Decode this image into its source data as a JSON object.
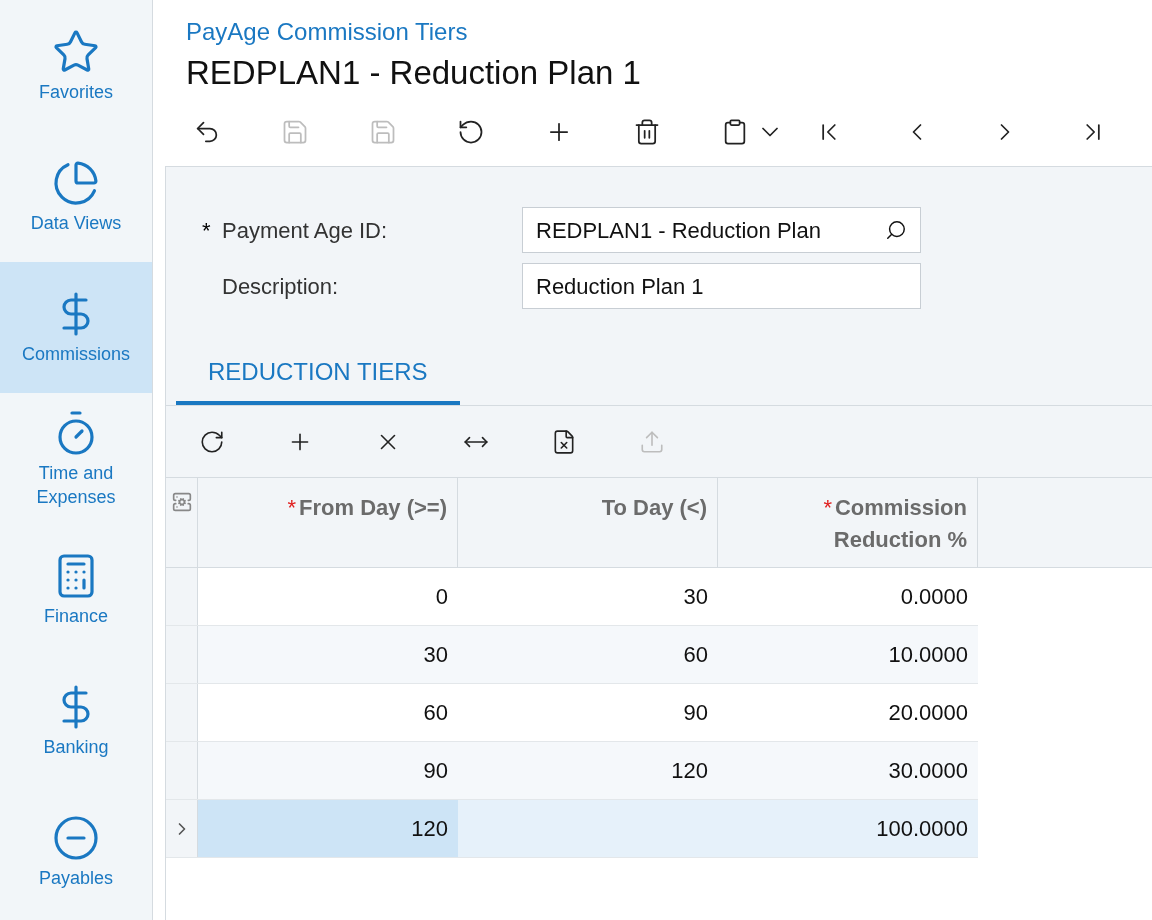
{
  "sidebar": {
    "items": [
      {
        "kind": "star",
        "label": "Favorites",
        "selected": false
      },
      {
        "kind": "pie",
        "label": "Data Views",
        "selected": false
      },
      {
        "kind": "dollar",
        "label": "Commissions",
        "selected": true
      },
      {
        "kind": "timer",
        "label": "Time and Expenses",
        "selected": false
      },
      {
        "kind": "calculator",
        "label": "Finance",
        "selected": false
      },
      {
        "kind": "dollar",
        "label": "Banking",
        "selected": false
      },
      {
        "kind": "minus",
        "label": "Payables",
        "selected": false
      }
    ]
  },
  "header": {
    "breadcrumb": "PayAge Commission Tiers",
    "title": "REDPLAN1 - Reduction Plan 1"
  },
  "toolbar": [
    {
      "kind": "back",
      "disabled": false
    },
    {
      "kind": "save-close",
      "disabled": true
    },
    {
      "kind": "save",
      "disabled": true
    },
    {
      "kind": "undo",
      "disabled": false
    },
    {
      "kind": "add",
      "disabled": false
    },
    {
      "kind": "delete",
      "disabled": false
    },
    {
      "kind": "clipboard",
      "disabled": false
    },
    {
      "kind": "dropdown",
      "disabled": false
    },
    {
      "kind": "first",
      "disabled": false
    },
    {
      "kind": "prev",
      "disabled": false
    },
    {
      "kind": "next",
      "disabled": false
    },
    {
      "kind": "last",
      "disabled": false
    }
  ],
  "form": {
    "fields": [
      {
        "label": "Payment Age ID:",
        "required_mark": "*",
        "value": "REDPLAN1 - Reduction Plan",
        "lookup": true
      },
      {
        "label": "Description:",
        "value": "Reduction Plan 1",
        "lookup": false
      }
    ]
  },
  "tabs": [
    {
      "label": "REDUCTION TIERS",
      "selected": true
    }
  ],
  "grid_toolbar": [
    {
      "kind": "refresh",
      "disabled": false
    },
    {
      "kind": "add",
      "disabled": false
    },
    {
      "kind": "remove",
      "disabled": false
    },
    {
      "kind": "fit",
      "disabled": false
    },
    {
      "kind": "excel",
      "disabled": false
    },
    {
      "kind": "upload",
      "disabled": true
    }
  ],
  "table": {
    "columns": [
      {
        "label": "From Day (>=)",
        "required_mark": "*"
      },
      {
        "label": "To Day (<)"
      },
      {
        "label": "Commission Reduction %",
        "required_mark": "*"
      }
    ],
    "rows": [
      {
        "selected": false,
        "cells": [
          "0",
          "30",
          "0.0000"
        ]
      },
      {
        "selected": false,
        "cells": [
          "30",
          "60",
          "10.0000"
        ]
      },
      {
        "selected": false,
        "cells": [
          "60",
          "90",
          "20.0000"
        ]
      },
      {
        "selected": false,
        "cells": [
          "90",
          "120",
          "30.0000"
        ]
      },
      {
        "selected": true,
        "cells": [
          "120",
          null,
          "100.0000"
        ]
      }
    ]
  }
}
